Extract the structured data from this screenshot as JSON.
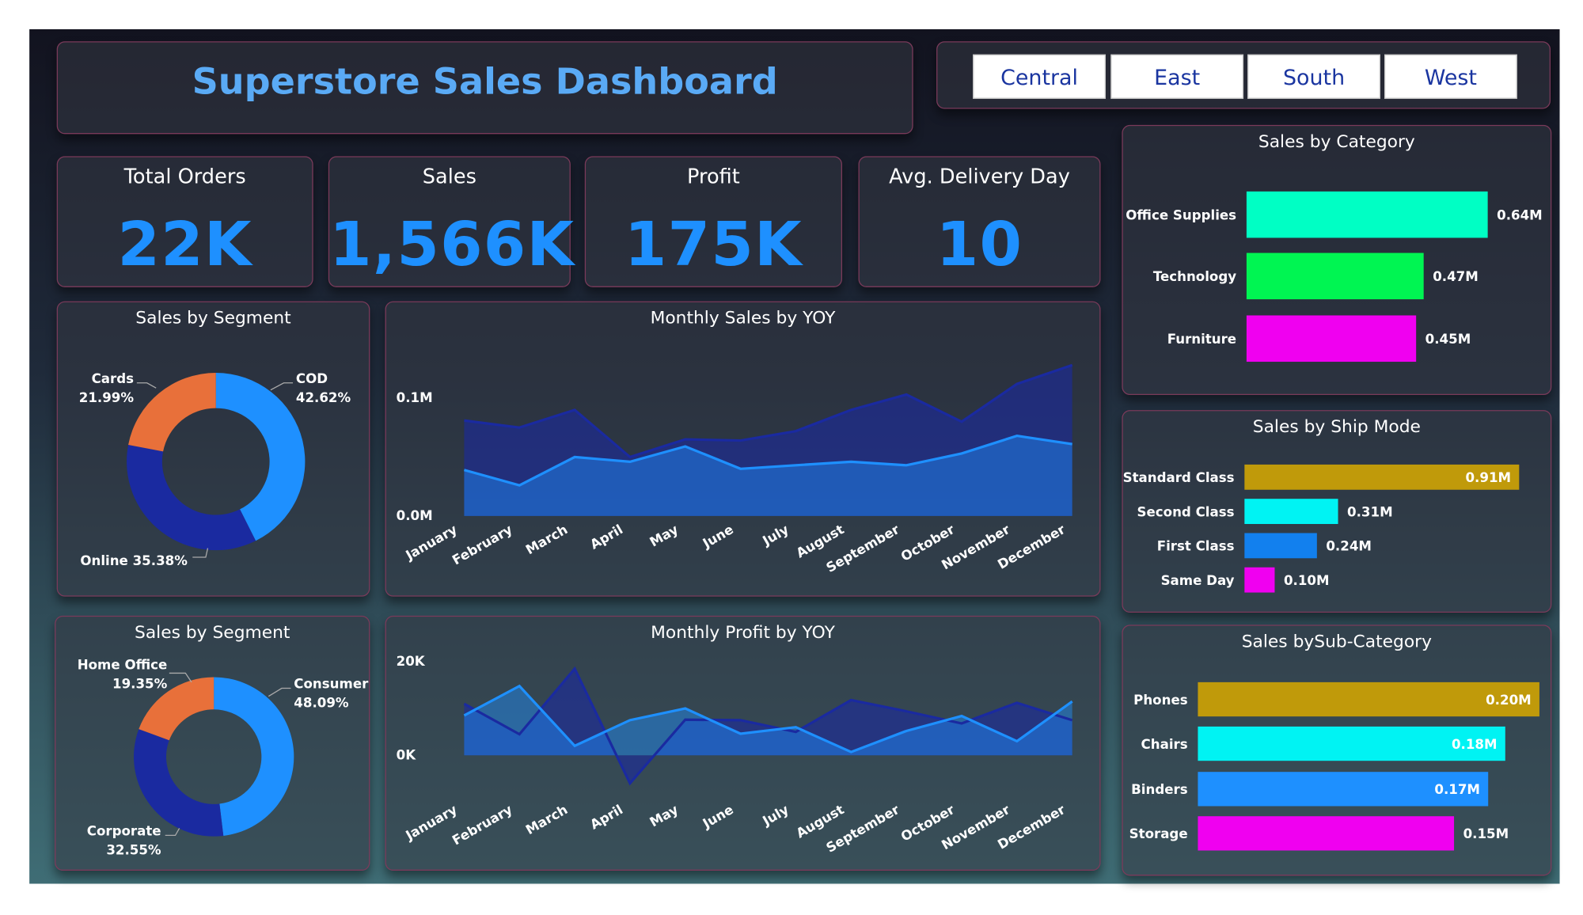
{
  "header": {
    "title": "Superstore Sales Dashboard"
  },
  "region_slicer": {
    "buttons": [
      "Central",
      "East",
      "South",
      "West"
    ]
  },
  "kpis": [
    {
      "title": "Total Orders",
      "value": "22K"
    },
    {
      "title": "Sales",
      "value": "1,566K"
    },
    {
      "title": "Profit",
      "value": "175K"
    },
    {
      "title": "Avg. Delivery Day",
      "value": "10"
    }
  ],
  "colors": {
    "accent": "#1e90ff",
    "dark_blue": "#1a2aa0",
    "orange": "#e8703a",
    "teal": "#00ffc4",
    "green": "#00f552",
    "magenta": "#f000f0",
    "gold": "#c09a0a",
    "cyan": "#00f3f3",
    "blue": "#1280ee"
  },
  "chart_data": [
    {
      "id": "segment_payment",
      "type": "pie",
      "title": "Sales by Segment",
      "slices": [
        {
          "name": "COD",
          "value": 42.62,
          "label": "42.62%",
          "color": "#1e90ff"
        },
        {
          "name": "Online",
          "value": 35.38,
          "label": "35.38%",
          "color": "#1a2aa0"
        },
        {
          "name": "Cards",
          "value": 21.99,
          "label": "21.99%",
          "color": "#e8703a"
        }
      ]
    },
    {
      "id": "segment_customer",
      "type": "pie",
      "title": "Sales by Segment",
      "slices": [
        {
          "name": "Consumer",
          "value": 48.09,
          "label": "48.09%",
          "color": "#1e90ff"
        },
        {
          "name": "Corporate",
          "value": 32.55,
          "label": "32.55%",
          "color": "#1a2aa0"
        },
        {
          "name": "Home Office",
          "value": 19.35,
          "label": "19.35%",
          "color": "#e8703a"
        }
      ]
    },
    {
      "id": "monthly_sales",
      "type": "area",
      "title": "Monthly Sales by YOY",
      "categories": [
        "January",
        "February",
        "March",
        "April",
        "May",
        "June",
        "July",
        "August",
        "September",
        "October",
        "November",
        "December"
      ],
      "yticks": [
        "0.0M",
        "0.1M"
      ],
      "ylim": [
        0,
        0.13
      ],
      "series": [
        {
          "values": [
            0.081,
            0.075,
            0.09,
            0.05,
            0.065,
            0.064,
            0.072,
            0.09,
            0.103,
            0.08,
            0.112,
            0.128
          ],
          "color": "#1a2aa0"
        },
        {
          "values": [
            0.039,
            0.026,
            0.05,
            0.046,
            0.059,
            0.04,
            0.043,
            0.046,
            0.043,
            0.053,
            0.068,
            0.061
          ],
          "color": "#1e90ff"
        }
      ]
    },
    {
      "id": "monthly_profit",
      "type": "area",
      "title": "Monthly Profit by YOY",
      "categories": [
        "January",
        "February",
        "March",
        "April",
        "May",
        "June",
        "July",
        "August",
        "September",
        "October",
        "November",
        "December"
      ],
      "yticks": [
        "0K",
        "20K"
      ],
      "ylim": [
        -7000,
        21000
      ],
      "series": [
        {
          "values": [
            11000,
            4500,
            18500,
            -6000,
            7600,
            7500,
            5000,
            11800,
            9400,
            6800,
            11200,
            7500
          ],
          "color": "#1a2aa0"
        },
        {
          "values": [
            8500,
            14800,
            2000,
            7500,
            10000,
            4600,
            6000,
            700,
            5200,
            8400,
            3000,
            11500
          ],
          "color": "#1e90ff"
        }
      ]
    },
    {
      "id": "sales_by_category",
      "type": "bar",
      "title": "Sales by Category",
      "categories": [
        "Office Supplies",
        "Technology",
        "Furniture"
      ],
      "values": [
        0.64,
        0.47,
        0.45
      ],
      "labels": [
        "0.64M",
        "0.47M",
        "0.45M"
      ],
      "colors": [
        "#00ffc4",
        "#00f552",
        "#f000f0"
      ],
      "xlim": [
        0,
        0.64
      ]
    },
    {
      "id": "sales_by_ship_mode",
      "type": "bar",
      "title": "Sales by Ship Mode",
      "categories": [
        "Standard Class",
        "Second Class",
        "First Class",
        "Same Day"
      ],
      "values": [
        0.91,
        0.31,
        0.24,
        0.1
      ],
      "labels": [
        "0.91M",
        "0.31M",
        "0.24M",
        "0.10M"
      ],
      "colors": [
        "#c09a0a",
        "#00f3f3",
        "#1280ee",
        "#f000f0"
      ],
      "xlim": [
        0,
        0.91
      ]
    },
    {
      "id": "sales_by_subcategory",
      "type": "bar",
      "title": "Sales bySub-Category",
      "categories": [
        "Phones",
        "Chairs",
        "Binders",
        "Storage"
      ],
      "values": [
        0.2,
        0.18,
        0.17,
        0.15
      ],
      "labels": [
        "0.20M",
        "0.18M",
        "0.17M",
        "0.15M"
      ],
      "colors": [
        "#c09a0a",
        "#00f3f3",
        "#1e90ff",
        "#f000f0"
      ],
      "xlim": [
        0,
        0.2
      ]
    }
  ]
}
